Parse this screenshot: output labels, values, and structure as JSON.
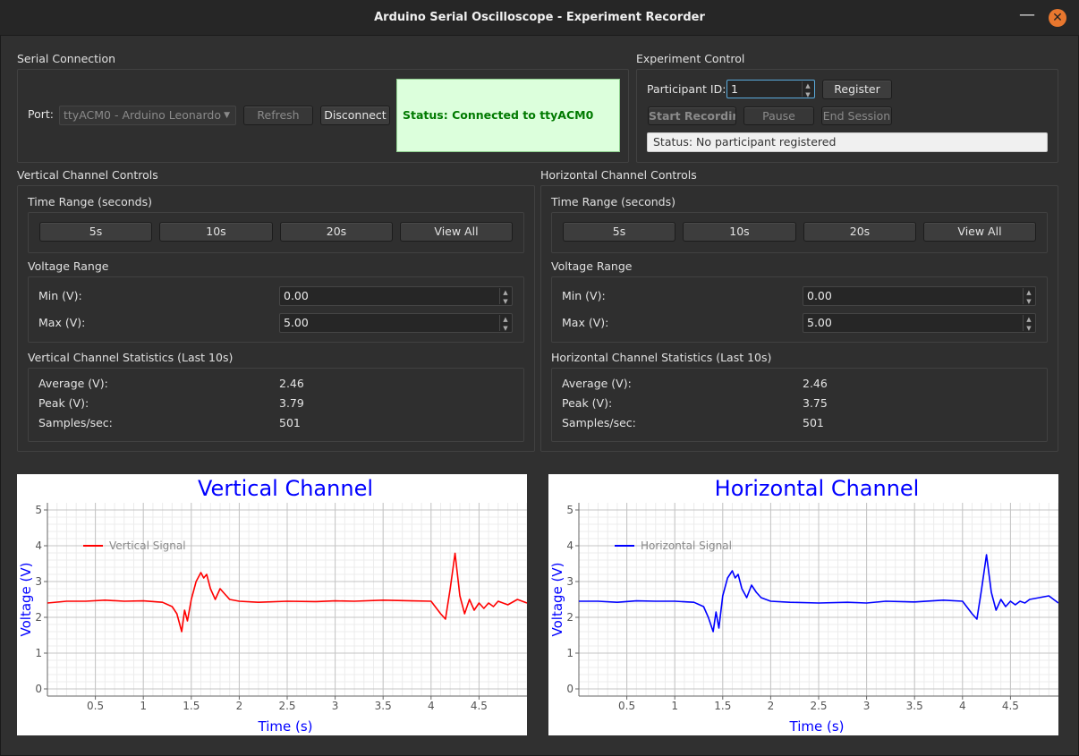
{
  "window": {
    "title": "Arduino Serial Oscilloscope - Experiment Recorder",
    "minimize_glyph": "—",
    "close_glyph": "✕"
  },
  "serial": {
    "section_title": "Serial Connection",
    "port_label": "Port:",
    "port_value": "ttyACM0 - Arduino Leonardo",
    "refresh_label": "Refresh",
    "disconnect_label": "Disconnect",
    "status": "Status: Connected to ttyACM0",
    "status_color": "#007a00"
  },
  "experiment": {
    "section_title": "Experiment Control",
    "participant_label": "Participant ID:",
    "participant_value": "1",
    "register_label": "Register",
    "start_label": "Start Recording",
    "pause_label": "Pause",
    "end_label": "End Session",
    "status": "Status: No participant registered"
  },
  "vertical_controls": {
    "section_title": "Vertical Channel Controls",
    "time_range_title": "Time Range (seconds)",
    "time_buttons": [
      "5s",
      "10s",
      "20s",
      "View All"
    ],
    "voltage_range_title": "Voltage Range",
    "min_label": "Min (V):",
    "min_value": "0.00",
    "max_label": "Max (V):",
    "max_value": "5.00",
    "stats_title": "Vertical Channel Statistics (Last 10s)",
    "avg_label": "Average (V):",
    "avg_value": "2.46",
    "peak_label": "Peak (V):",
    "peak_value": "3.79",
    "sps_label": "Samples/sec:",
    "sps_value": "501"
  },
  "horizontal_controls": {
    "section_title": "Horizontal Channel Controls",
    "time_range_title": "Time Range (seconds)",
    "time_buttons": [
      "5s",
      "10s",
      "20s",
      "View All"
    ],
    "voltage_range_title": "Voltage Range",
    "min_label": "Min (V):",
    "min_value": "0.00",
    "max_label": "Max (V):",
    "max_value": "5.00",
    "stats_title": "Horizontal Channel Statistics (Last 10s)",
    "avg_label": "Average (V):",
    "avg_value": "2.46",
    "peak_label": "Peak (V):",
    "peak_value": "3.75",
    "sps_label": "Samples/sec:",
    "sps_value": "501"
  },
  "chart_data": [
    {
      "type": "line",
      "title": "Vertical Channel",
      "xlabel": "Time (s)",
      "ylabel": "Voltage (V)",
      "xlim": [
        0,
        5
      ],
      "ylim": [
        -0.2,
        5.2
      ],
      "xticks": [
        "0.5",
        "1",
        "1.5",
        "2",
        "2.5",
        "3",
        "3.5",
        "4",
        "4.5"
      ],
      "yticks": [
        "0",
        "1",
        "2",
        "3",
        "4",
        "5"
      ],
      "grid": true,
      "legend_position": "top-left",
      "label_color": "#0000ff",
      "series": [
        {
          "name": "Vertical Signal",
          "color": "#ff0000",
          "x": [
            0,
            0.2,
            0.4,
            0.6,
            0.8,
            1.0,
            1.2,
            1.3,
            1.35,
            1.4,
            1.43,
            1.46,
            1.5,
            1.55,
            1.6,
            1.63,
            1.66,
            1.7,
            1.75,
            1.8,
            1.85,
            1.9,
            2.0,
            2.2,
            2.5,
            2.8,
            3.0,
            3.2,
            3.5,
            3.8,
            4.0,
            4.1,
            4.15,
            4.2,
            4.25,
            4.3,
            4.35,
            4.4,
            4.45,
            4.5,
            4.55,
            4.6,
            4.65,
            4.7,
            4.8,
            4.9,
            5.0
          ],
          "y": [
            2.4,
            2.45,
            2.45,
            2.48,
            2.45,
            2.46,
            2.42,
            2.3,
            2.1,
            1.6,
            2.2,
            1.9,
            2.5,
            3.0,
            3.25,
            3.1,
            3.2,
            2.8,
            2.5,
            2.8,
            2.65,
            2.5,
            2.45,
            2.42,
            2.45,
            2.44,
            2.46,
            2.45,
            2.48,
            2.46,
            2.45,
            2.1,
            1.95,
            2.8,
            3.79,
            2.6,
            2.1,
            2.5,
            2.2,
            2.4,
            2.25,
            2.4,
            2.3,
            2.45,
            2.35,
            2.5,
            2.4
          ]
        }
      ]
    },
    {
      "type": "line",
      "title": "Horizontal Channel",
      "xlabel": "Time (s)",
      "ylabel": "Voltage (V)",
      "xlim": [
        0,
        5
      ],
      "ylim": [
        -0.2,
        5.2
      ],
      "xticks": [
        "0.5",
        "1",
        "1.5",
        "2",
        "2.5",
        "3",
        "3.5",
        "4",
        "4.5"
      ],
      "yticks": [
        "0",
        "1",
        "2",
        "3",
        "4",
        "5"
      ],
      "grid": true,
      "legend_position": "top-left",
      "label_color": "#0000ff",
      "series": [
        {
          "name": "Horizontal Signal",
          "color": "#0000ff",
          "x": [
            0,
            0.2,
            0.4,
            0.6,
            0.8,
            1.0,
            1.2,
            1.3,
            1.35,
            1.4,
            1.43,
            1.46,
            1.5,
            1.55,
            1.6,
            1.63,
            1.66,
            1.7,
            1.75,
            1.8,
            1.85,
            1.9,
            2.0,
            2.2,
            2.5,
            2.8,
            3.0,
            3.2,
            3.5,
            3.8,
            4.0,
            4.1,
            4.15,
            4.2,
            4.25,
            4.3,
            4.35,
            4.4,
            4.45,
            4.5,
            4.55,
            4.6,
            4.65,
            4.7,
            4.8,
            4.9,
            5.0
          ],
          "y": [
            2.45,
            2.45,
            2.42,
            2.46,
            2.45,
            2.45,
            2.42,
            2.3,
            2.0,
            1.6,
            2.15,
            1.7,
            2.6,
            3.1,
            3.3,
            3.1,
            3.2,
            2.8,
            2.55,
            2.9,
            2.7,
            2.55,
            2.45,
            2.42,
            2.4,
            2.42,
            2.4,
            2.45,
            2.43,
            2.48,
            2.45,
            2.1,
            1.95,
            2.8,
            3.75,
            2.7,
            2.2,
            2.5,
            2.3,
            2.45,
            2.35,
            2.45,
            2.4,
            2.5,
            2.55,
            2.6,
            2.4
          ]
        }
      ]
    }
  ]
}
